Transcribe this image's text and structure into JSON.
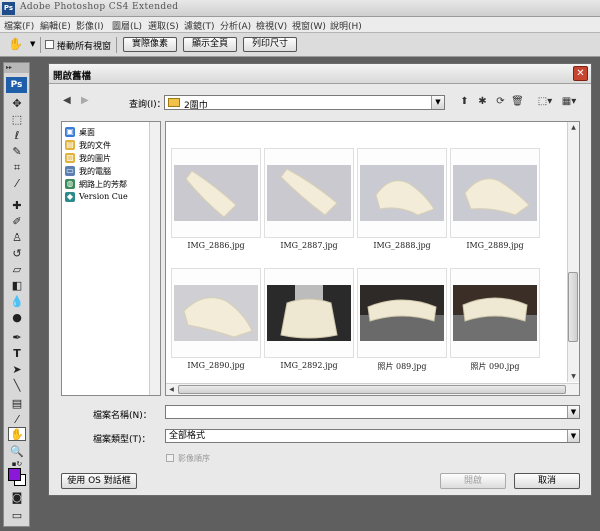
{
  "app": {
    "title": "Adobe Photoshop CS4 Extended",
    "logo": "Ps"
  },
  "menu": [
    "檔案(F)",
    "編輯(E)",
    "影像(I)",
    "圖層(L)",
    "選取(S)",
    "濾鏡(T)",
    "分析(A)",
    "檢視(V)",
    "視窗(W)",
    "說明(H)"
  ],
  "options_bar": {
    "scroll_all_label": "捲動所有視窗",
    "actual_pixels": "實際像素",
    "fit_screen": "顯示全頁",
    "print_size": "列印尺寸"
  },
  "dialog": {
    "title": "開啟舊檔",
    "close": "✕",
    "look_in_label": "查詢(I)：",
    "look_in_value": "2圍巾",
    "places": [
      {
        "label": "桌面",
        "icon": "desktop-icon",
        "color": "#3a7bd5"
      },
      {
        "label": "我的文件",
        "icon": "documents-icon",
        "color": "#e0b23c"
      },
      {
        "label": "我的圖片",
        "icon": "pictures-icon",
        "color": "#e0b23c"
      },
      {
        "label": "我的電腦",
        "icon": "computer-icon",
        "color": "#5a7fb0"
      },
      {
        "label": "網路上的芳鄰",
        "icon": "network-icon",
        "color": "#3a8c5a"
      },
      {
        "label": "Version Cue",
        "icon": "version-cue-icon",
        "color": "#2d8a8a"
      }
    ],
    "files": [
      {
        "name": "IMG_2886.jpg",
        "kind": "white"
      },
      {
        "name": "IMG_2887.jpg",
        "kind": "white"
      },
      {
        "name": "IMG_2888.jpg",
        "kind": "white"
      },
      {
        "name": "IMG_2889.jpg",
        "kind": "white"
      },
      {
        "name": "IMG_2890.jpg",
        "kind": "white"
      },
      {
        "name": "IMG_2892.jpg",
        "kind": "dark"
      },
      {
        "name": "照片 089.jpg",
        "kind": "dark"
      },
      {
        "name": "照片 090.jpg",
        "kind": "dark"
      }
    ],
    "file_name_label": "檔案名稱(N)：",
    "file_name_value": "",
    "file_type_label": "檔案類型(T)：",
    "file_type_value": "全部格式",
    "image_sequence_label": "影像順序",
    "use_os_dialog": "使用 OS 對話框",
    "open_button": "開啟",
    "cancel_button": "取消"
  },
  "colors": {
    "foreground": "#8a18d8",
    "background": "#ffffff",
    "close_button": "#c7442f"
  }
}
